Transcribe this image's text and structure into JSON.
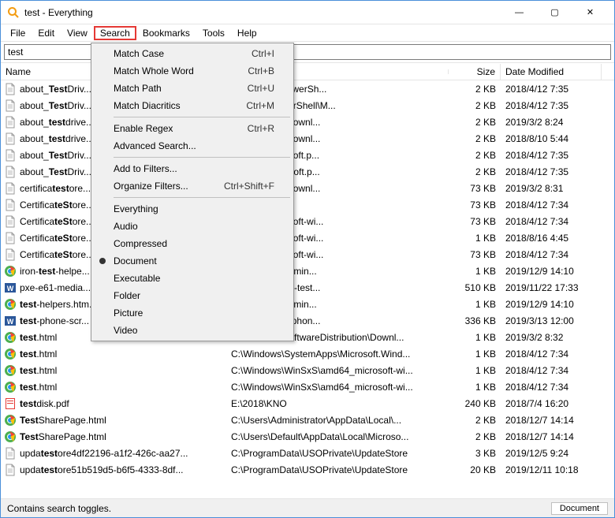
{
  "window": {
    "title": "test - Everything"
  },
  "winbuttons": {
    "min": "—",
    "max": "▢",
    "close": "✕"
  },
  "menubar": {
    "items": [
      {
        "label": "File"
      },
      {
        "label": "Edit"
      },
      {
        "label": "View"
      },
      {
        "label": "Search",
        "highlighted": true
      },
      {
        "label": "Bookmarks"
      },
      {
        "label": "Tools"
      },
      {
        "label": "Help"
      }
    ]
  },
  "search": {
    "value": "test"
  },
  "columns": {
    "name": "Name",
    "path": "",
    "size": "Size",
    "date": "Date Modified"
  },
  "dropdown": {
    "items": [
      {
        "label": "Match Case",
        "shortcut": "Ctrl+I"
      },
      {
        "label": "Match Whole Word",
        "shortcut": "Ctrl+B"
      },
      {
        "label": "Match Path",
        "shortcut": "Ctrl+U"
      },
      {
        "label": "Match Diacritics",
        "shortcut": "Ctrl+M"
      },
      {
        "sep": true
      },
      {
        "label": "Enable Regex",
        "shortcut": "Ctrl+R"
      },
      {
        "label": "Advanced Search..."
      },
      {
        "sep": true
      },
      {
        "label": "Add to Filters..."
      },
      {
        "label": "Organize Filters...",
        "shortcut": "Ctrl+Shift+F"
      },
      {
        "sep": true
      },
      {
        "label": "Everything"
      },
      {
        "label": "Audio"
      },
      {
        "label": "Compressed"
      },
      {
        "label": "Document",
        "bullet": true
      },
      {
        "label": "Executable"
      },
      {
        "label": "Folder"
      },
      {
        "label": "Picture"
      },
      {
        "label": "Video"
      }
    ]
  },
  "files": [
    {
      "icon": "txt",
      "pre": "about_",
      "match": "Test",
      "post": "Driv...",
      "path": "5)\\WindowsPowerSh...",
      "size": "2 KB",
      "date": "2018/4/12 7:35"
    },
    {
      "icon": "txt",
      "pre": "about_",
      "match": "Test",
      "post": "Driv...",
      "path": "WindowsPowerShell\\M...",
      "size": "2 KB",
      "date": "2018/4/12 7:35"
    },
    {
      "icon": "txt",
      "pre": "about_",
      "match": "test",
      "post": "drive...",
      "path": "eDistribution\\Downl...",
      "size": "2 KB",
      "date": "2019/3/2 8:24"
    },
    {
      "icon": "txt",
      "pre": "about_",
      "match": "test",
      "post": "drive...",
      "path": "eDistribution\\Downl...",
      "size": "2 KB",
      "date": "2018/8/10 5:44"
    },
    {
      "icon": "txt",
      "pre": "about_",
      "match": "Test",
      "post": "Driv...",
      "path": "amd64_microsoft.p...",
      "size": "2 KB",
      "date": "2018/4/12 7:35"
    },
    {
      "icon": "txt",
      "pre": "about_",
      "match": "Test",
      "post": "Driv...",
      "path": "wow64_microsoft.p...",
      "size": "2 KB",
      "date": "2018/4/12 7:35"
    },
    {
      "icon": "txt",
      "pre": "certifica",
      "match": "test",
      "post": "ore...",
      "path": "eDistribution\\Downl...",
      "size": "73 KB",
      "date": "2019/3/2 8:31"
    },
    {
      "icon": "txt",
      "pre": "Certifica",
      "match": "teSt",
      "post": "ore...",
      "path": "2\\DDFs",
      "size": "73 KB",
      "date": "2018/4/12 7:34"
    },
    {
      "icon": "txt",
      "pre": "Certifica",
      "match": "teSt",
      "post": "ore...",
      "path": "amd64_microsoft-wi...",
      "size": "73 KB",
      "date": "2018/4/12 7:34"
    },
    {
      "icon": "txt",
      "pre": "Certifica",
      "match": "teSt",
      "post": "ore...",
      "path": "amd64_microsoft-wi...",
      "size": "1 KB",
      "date": "2018/8/16 4:45"
    },
    {
      "icon": "txt",
      "pre": "Certifica",
      "match": "teSt",
      "post": "ore...",
      "path": "amd64_microsoft-wi...",
      "size": "73 KB",
      "date": "2018/4/12 7:34"
    },
    {
      "icon": "chrome",
      "pre": "iron-",
      "match": "test",
      "post": "-helpe...",
      "path": "r\\AppData\\Roamin...",
      "size": "1 KB",
      "date": "2019/12/9 14:10"
    },
    {
      "icon": "word",
      "pre": "pxe-e61-media...",
      "match": "",
      "post": "",
      "path": "pxe-e61-media-test...",
      "size": "510 KB",
      "date": "2019/11/22 17:33"
    },
    {
      "icon": "chrome",
      "pre": "",
      "match": "test",
      "post": "-helpers.htm...",
      "path": "r\\AppData\\Roamin...",
      "size": "1 KB",
      "date": "2019/12/9 14:10"
    },
    {
      "icon": "word",
      "pre": "",
      "match": "test",
      "post": "-phone-scr...",
      "path": "\\313\\3.13 test-phon...",
      "size": "336 KB",
      "date": "2019/3/13 12:00"
    },
    {
      "icon": "chrome",
      "pre": "",
      "match": "test",
      "post": ".html",
      "path": "C:\\Windows\\softwareDistribution\\Downl...",
      "size": "1 KB",
      "date": "2019/3/2 8:32"
    },
    {
      "icon": "chrome",
      "pre": "",
      "match": "test",
      "post": ".html",
      "path": "C:\\Windows\\SystemApps\\Microsoft.Wind...",
      "size": "1 KB",
      "date": "2018/4/12 7:34"
    },
    {
      "icon": "chrome",
      "pre": "",
      "match": "test",
      "post": ".html",
      "path": "C:\\Windows\\WinSxS\\amd64_microsoft-wi...",
      "size": "1 KB",
      "date": "2018/4/12 7:34"
    },
    {
      "icon": "chrome",
      "pre": "",
      "match": "test",
      "post": ".html",
      "path": "C:\\Windows\\WinSxS\\amd64_microsoft-wi...",
      "size": "1 KB",
      "date": "2018/4/12 7:34"
    },
    {
      "icon": "pdf",
      "pre": "",
      "match": "test",
      "post": "disk.pdf",
      "path": "E:\\2018\\KNO",
      "size": "240 KB",
      "date": "2018/7/4 16:20"
    },
    {
      "icon": "chrome",
      "pre": "",
      "match": "Test",
      "post": "SharePage.html",
      "path": "C:\\Users\\Administrator\\AppData\\Local\\...",
      "size": "2 KB",
      "date": "2018/12/7 14:14"
    },
    {
      "icon": "chrome",
      "pre": "",
      "match": "Test",
      "post": "SharePage.html",
      "path": "C:\\Users\\Default\\AppData\\Local\\Microso...",
      "size": "2 KB",
      "date": "2018/12/7 14:14"
    },
    {
      "icon": "txt",
      "pre": "upda",
      "match": "test",
      "post": "ore4df22196-a1f2-426c-aa27...",
      "path": "C:\\ProgramData\\USOPrivate\\UpdateStore",
      "size": "3 KB",
      "date": "2019/12/5 9:24"
    },
    {
      "icon": "txt",
      "pre": "upda",
      "match": "test",
      "post": "ore51b519d5-b6f5-4333-8df...",
      "path": "C:\\ProgramData\\USOPrivate\\UpdateStore",
      "size": "20 KB",
      "date": "2019/12/11 10:18"
    }
  ],
  "statusbar": {
    "left": "Contains search toggles.",
    "right": "Document"
  }
}
